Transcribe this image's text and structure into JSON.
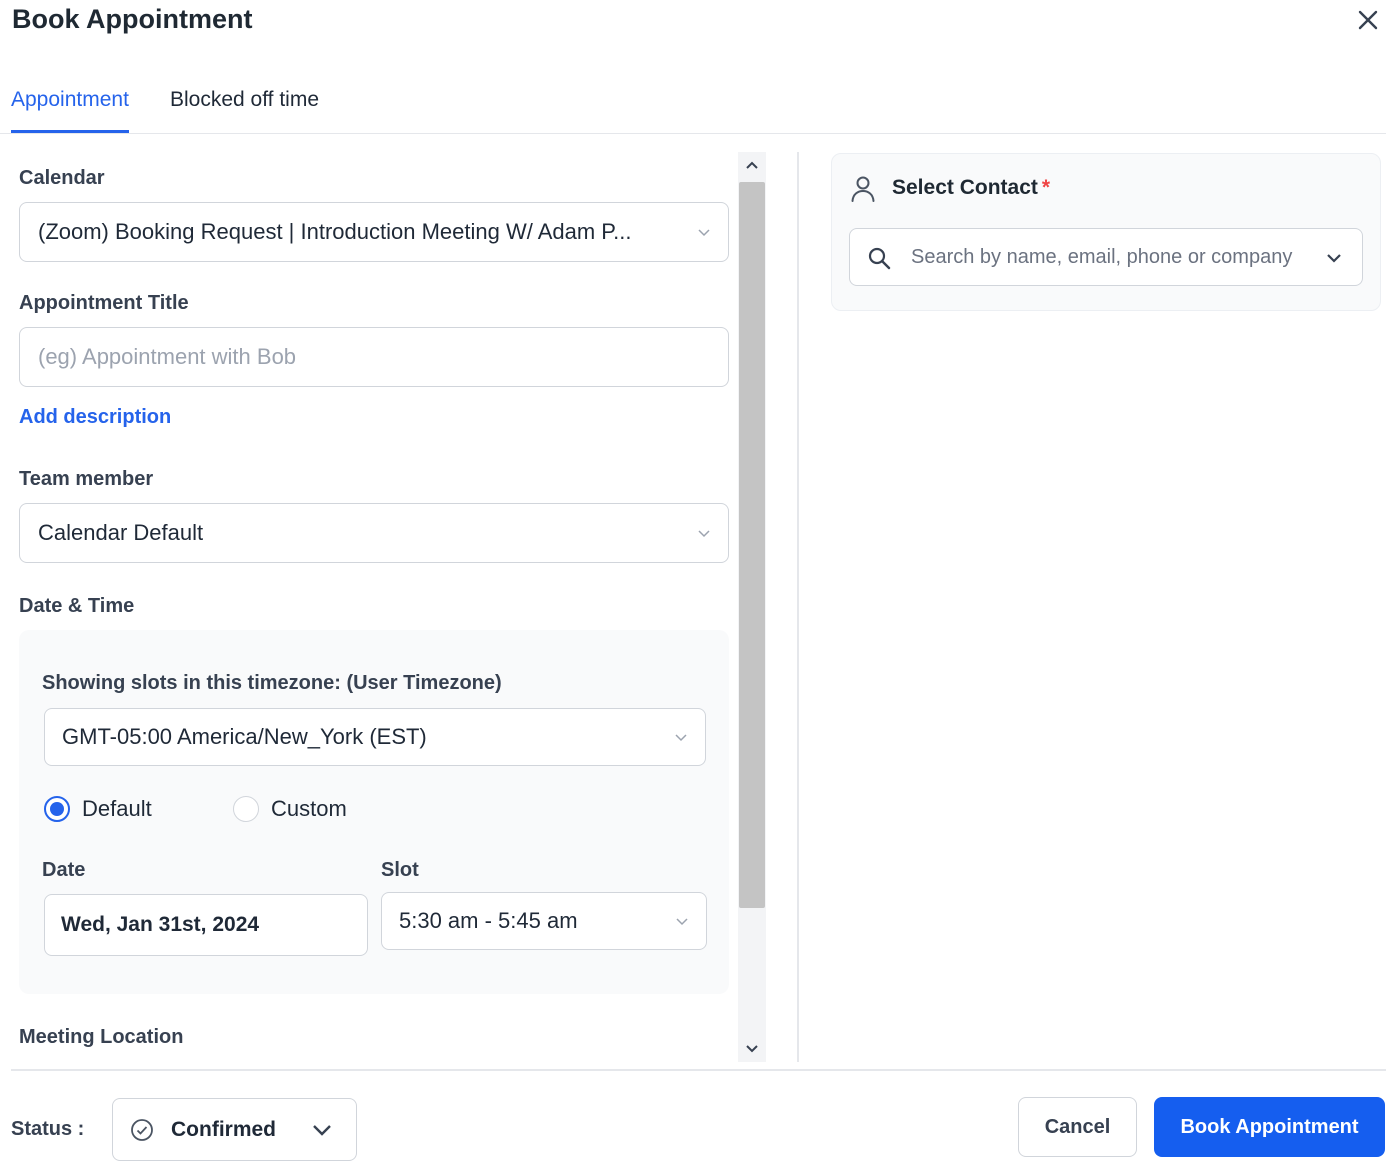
{
  "modal": {
    "title": "Book Appointment"
  },
  "tabs": [
    {
      "label": "Appointment",
      "active": true
    },
    {
      "label": "Blocked off time",
      "active": false
    }
  ],
  "form": {
    "calendar": {
      "label": "Calendar",
      "value": "(Zoom) Booking Request | Introduction Meeting W/ Adam P..."
    },
    "appointment_title": {
      "label": "Appointment Title",
      "placeholder": "(eg) Appointment with Bob",
      "value": ""
    },
    "add_description_label": "Add description",
    "team_member": {
      "label": "Team member",
      "value": "Calendar Default"
    },
    "date_time": {
      "label": "Date & Time",
      "timezone_label": "Showing slots in this timezone: (User Timezone)",
      "timezone_value": "GMT-05:00 America/New_York (EST)",
      "radio_options": [
        {
          "label": "Default",
          "checked": true
        },
        {
          "label": "Custom",
          "checked": false
        }
      ],
      "date_label": "Date",
      "date_value": "Wed, Jan 31st, 2024",
      "slot_label": "Slot",
      "slot_value": "5:30 am - 5:45 am"
    },
    "meeting_location_label": "Meeting Location"
  },
  "contact": {
    "title": "Select Contact",
    "required_mark": "*",
    "search_placeholder": "Search by name, email, phone or company"
  },
  "footer": {
    "status_label": "Status :",
    "status_value": "Confirmed",
    "cancel_label": "Cancel",
    "book_label": "Book Appointment"
  },
  "colors": {
    "accent": "#2563eb",
    "primary_button": "#155eef",
    "required": "#ef4444"
  },
  "icons": [
    "close-icon",
    "chevron-down-icon",
    "user-icon",
    "search-icon",
    "check-circle-icon",
    "chevron-up-icon"
  ]
}
